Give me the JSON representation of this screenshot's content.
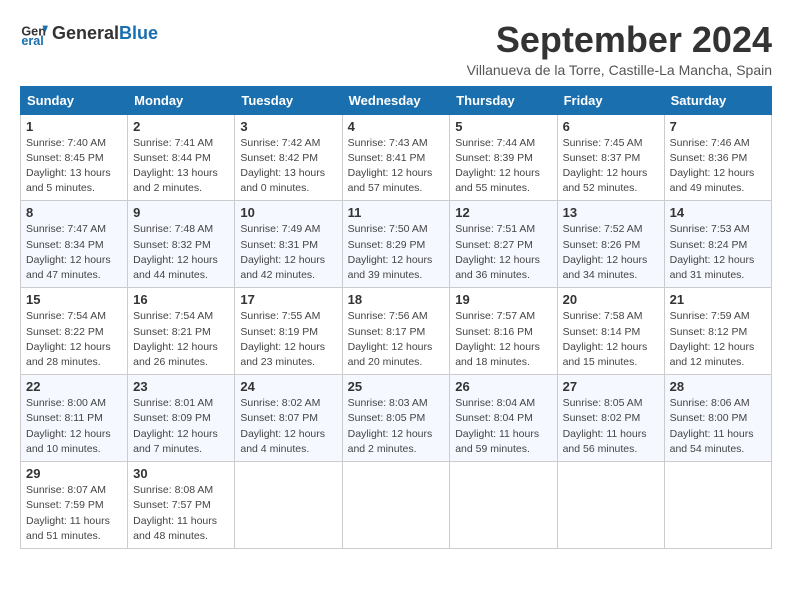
{
  "logo": {
    "text_general": "General",
    "text_blue": "Blue"
  },
  "title": "September 2024",
  "subtitle": "Villanueva de la Torre, Castille-La Mancha, Spain",
  "days_of_week": [
    "Sunday",
    "Monday",
    "Tuesday",
    "Wednesday",
    "Thursday",
    "Friday",
    "Saturday"
  ],
  "weeks": [
    [
      {
        "day": "1",
        "sunrise": "Sunrise: 7:40 AM",
        "sunset": "Sunset: 8:45 PM",
        "daylight": "Daylight: 13 hours and 5 minutes."
      },
      {
        "day": "2",
        "sunrise": "Sunrise: 7:41 AM",
        "sunset": "Sunset: 8:44 PM",
        "daylight": "Daylight: 13 hours and 2 minutes."
      },
      {
        "day": "3",
        "sunrise": "Sunrise: 7:42 AM",
        "sunset": "Sunset: 8:42 PM",
        "daylight": "Daylight: 13 hours and 0 minutes."
      },
      {
        "day": "4",
        "sunrise": "Sunrise: 7:43 AM",
        "sunset": "Sunset: 8:41 PM",
        "daylight": "Daylight: 12 hours and 57 minutes."
      },
      {
        "day": "5",
        "sunrise": "Sunrise: 7:44 AM",
        "sunset": "Sunset: 8:39 PM",
        "daylight": "Daylight: 12 hours and 55 minutes."
      },
      {
        "day": "6",
        "sunrise": "Sunrise: 7:45 AM",
        "sunset": "Sunset: 8:37 PM",
        "daylight": "Daylight: 12 hours and 52 minutes."
      },
      {
        "day": "7",
        "sunrise": "Sunrise: 7:46 AM",
        "sunset": "Sunset: 8:36 PM",
        "daylight": "Daylight: 12 hours and 49 minutes."
      }
    ],
    [
      {
        "day": "8",
        "sunrise": "Sunrise: 7:47 AM",
        "sunset": "Sunset: 8:34 PM",
        "daylight": "Daylight: 12 hours and 47 minutes."
      },
      {
        "day": "9",
        "sunrise": "Sunrise: 7:48 AM",
        "sunset": "Sunset: 8:32 PM",
        "daylight": "Daylight: 12 hours and 44 minutes."
      },
      {
        "day": "10",
        "sunrise": "Sunrise: 7:49 AM",
        "sunset": "Sunset: 8:31 PM",
        "daylight": "Daylight: 12 hours and 42 minutes."
      },
      {
        "day": "11",
        "sunrise": "Sunrise: 7:50 AM",
        "sunset": "Sunset: 8:29 PM",
        "daylight": "Daylight: 12 hours and 39 minutes."
      },
      {
        "day": "12",
        "sunrise": "Sunrise: 7:51 AM",
        "sunset": "Sunset: 8:27 PM",
        "daylight": "Daylight: 12 hours and 36 minutes."
      },
      {
        "day": "13",
        "sunrise": "Sunrise: 7:52 AM",
        "sunset": "Sunset: 8:26 PM",
        "daylight": "Daylight: 12 hours and 34 minutes."
      },
      {
        "day": "14",
        "sunrise": "Sunrise: 7:53 AM",
        "sunset": "Sunset: 8:24 PM",
        "daylight": "Daylight: 12 hours and 31 minutes."
      }
    ],
    [
      {
        "day": "15",
        "sunrise": "Sunrise: 7:54 AM",
        "sunset": "Sunset: 8:22 PM",
        "daylight": "Daylight: 12 hours and 28 minutes."
      },
      {
        "day": "16",
        "sunrise": "Sunrise: 7:54 AM",
        "sunset": "Sunset: 8:21 PM",
        "daylight": "Daylight: 12 hours and 26 minutes."
      },
      {
        "day": "17",
        "sunrise": "Sunrise: 7:55 AM",
        "sunset": "Sunset: 8:19 PM",
        "daylight": "Daylight: 12 hours and 23 minutes."
      },
      {
        "day": "18",
        "sunrise": "Sunrise: 7:56 AM",
        "sunset": "Sunset: 8:17 PM",
        "daylight": "Daylight: 12 hours and 20 minutes."
      },
      {
        "day": "19",
        "sunrise": "Sunrise: 7:57 AM",
        "sunset": "Sunset: 8:16 PM",
        "daylight": "Daylight: 12 hours and 18 minutes."
      },
      {
        "day": "20",
        "sunrise": "Sunrise: 7:58 AM",
        "sunset": "Sunset: 8:14 PM",
        "daylight": "Daylight: 12 hours and 15 minutes."
      },
      {
        "day": "21",
        "sunrise": "Sunrise: 7:59 AM",
        "sunset": "Sunset: 8:12 PM",
        "daylight": "Daylight: 12 hours and 12 minutes."
      }
    ],
    [
      {
        "day": "22",
        "sunrise": "Sunrise: 8:00 AM",
        "sunset": "Sunset: 8:11 PM",
        "daylight": "Daylight: 12 hours and 10 minutes."
      },
      {
        "day": "23",
        "sunrise": "Sunrise: 8:01 AM",
        "sunset": "Sunset: 8:09 PM",
        "daylight": "Daylight: 12 hours and 7 minutes."
      },
      {
        "day": "24",
        "sunrise": "Sunrise: 8:02 AM",
        "sunset": "Sunset: 8:07 PM",
        "daylight": "Daylight: 12 hours and 4 minutes."
      },
      {
        "day": "25",
        "sunrise": "Sunrise: 8:03 AM",
        "sunset": "Sunset: 8:05 PM",
        "daylight": "Daylight: 12 hours and 2 minutes."
      },
      {
        "day": "26",
        "sunrise": "Sunrise: 8:04 AM",
        "sunset": "Sunset: 8:04 PM",
        "daylight": "Daylight: 11 hours and 59 minutes."
      },
      {
        "day": "27",
        "sunrise": "Sunrise: 8:05 AM",
        "sunset": "Sunset: 8:02 PM",
        "daylight": "Daylight: 11 hours and 56 minutes."
      },
      {
        "day": "28",
        "sunrise": "Sunrise: 8:06 AM",
        "sunset": "Sunset: 8:00 PM",
        "daylight": "Daylight: 11 hours and 54 minutes."
      }
    ],
    [
      {
        "day": "29",
        "sunrise": "Sunrise: 8:07 AM",
        "sunset": "Sunset: 7:59 PM",
        "daylight": "Daylight: 11 hours and 51 minutes."
      },
      {
        "day": "30",
        "sunrise": "Sunrise: 8:08 AM",
        "sunset": "Sunset: 7:57 PM",
        "daylight": "Daylight: 11 hours and 48 minutes."
      },
      null,
      null,
      null,
      null,
      null
    ]
  ]
}
